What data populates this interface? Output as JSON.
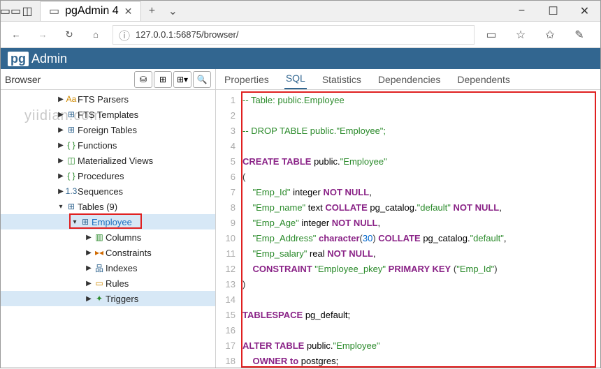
{
  "window": {
    "tab_title": "pgAdmin 4"
  },
  "addressbar": {
    "url": "127.0.0.1:56875/browser/"
  },
  "pgadmin": {
    "logo_prefix": "pg",
    "logo_text": "Admin"
  },
  "browser": {
    "title": "Browser",
    "watermark": "yiidian.com",
    "tree": [
      {
        "indent": 80,
        "exp": "▶",
        "icon": "Aa",
        "icon_color": "#d08a00",
        "label": "FTS Parsers"
      },
      {
        "indent": 80,
        "exp": "▶",
        "icon": "⊞",
        "icon_color": "#326690",
        "label": "FTS Templates"
      },
      {
        "indent": 80,
        "exp": "▶",
        "icon": "⊞",
        "icon_color": "#326690",
        "label": "Foreign Tables"
      },
      {
        "indent": 80,
        "exp": "▶",
        "icon": "{ }",
        "icon_color": "#2a8a2a",
        "label": "Functions"
      },
      {
        "indent": 80,
        "exp": "▶",
        "icon": "◫",
        "icon_color": "#2a8a2a",
        "label": "Materialized Views"
      },
      {
        "indent": 80,
        "exp": "▶",
        "icon": "{ }",
        "icon_color": "#2a8a2a",
        "label": "Procedures"
      },
      {
        "indent": 80,
        "exp": "▶",
        "icon": "1.3",
        "icon_color": "#326690",
        "label": "Sequences"
      },
      {
        "indent": 80,
        "exp": "▾",
        "icon": "⊞",
        "icon_color": "#326690",
        "label": "Tables (9)"
      },
      {
        "indent": 100,
        "exp": "▾",
        "icon": "⊞",
        "icon_color": "#326690",
        "label": "Employee",
        "selected": true,
        "blue": true,
        "boxed": true
      },
      {
        "indent": 120,
        "exp": "▶",
        "icon": "▥",
        "icon_color": "#2a8a2a",
        "label": "Columns"
      },
      {
        "indent": 120,
        "exp": "▶",
        "icon": "▸◂",
        "icon_color": "#d06a00",
        "label": "Constraints"
      },
      {
        "indent": 120,
        "exp": "▶",
        "icon": "品",
        "icon_color": "#326690",
        "label": "Indexes"
      },
      {
        "indent": 120,
        "exp": "▶",
        "icon": "▭",
        "icon_color": "#d08a00",
        "label": "Rules"
      },
      {
        "indent": 120,
        "exp": "▶",
        "icon": "✦",
        "icon_color": "#2a8a2a",
        "label": "Triggers",
        "selected_row": true
      }
    ]
  },
  "tabs": {
    "items": [
      "Properties",
      "SQL",
      "Statistics",
      "Dependencies",
      "Dependents"
    ],
    "active": 1
  },
  "code": {
    "lines": [
      [
        {
          "cls": "cmt",
          "t": "-- Table: public.Employee"
        }
      ],
      [],
      [
        {
          "cls": "cmt",
          "t": "-- DROP TABLE public.\"Employee\";"
        }
      ],
      [],
      [
        {
          "cls": "kw",
          "t": "CREATE TABLE"
        },
        {
          "t": " public."
        },
        {
          "cls": "str",
          "t": "\"Employee\""
        }
      ],
      [
        {
          "cls": "paren",
          "t": "("
        }
      ],
      [
        {
          "t": "    "
        },
        {
          "cls": "str",
          "t": "\"Emp_Id\""
        },
        {
          "t": " integer "
        },
        {
          "cls": "kw",
          "t": "NOT NULL"
        },
        {
          "t": ","
        }
      ],
      [
        {
          "t": "    "
        },
        {
          "cls": "str",
          "t": "\"Emp_name\""
        },
        {
          "t": " text "
        },
        {
          "cls": "kw",
          "t": "COLLATE"
        },
        {
          "t": " pg_catalog."
        },
        {
          "cls": "str",
          "t": "\"default\""
        },
        {
          "t": " "
        },
        {
          "cls": "kw",
          "t": "NOT NULL"
        },
        {
          "t": ","
        }
      ],
      [
        {
          "t": "    "
        },
        {
          "cls": "str",
          "t": "\"Emp_Age\""
        },
        {
          "t": " integer "
        },
        {
          "cls": "kw",
          "t": "NOT NULL"
        },
        {
          "t": ","
        }
      ],
      [
        {
          "t": "    "
        },
        {
          "cls": "str",
          "t": "\"Emp_Address\""
        },
        {
          "t": " "
        },
        {
          "cls": "typ",
          "t": "character"
        },
        {
          "cls": "paren",
          "t": "("
        },
        {
          "cls": "num",
          "t": "30"
        },
        {
          "cls": "paren",
          "t": ")"
        },
        {
          "t": " "
        },
        {
          "cls": "kw",
          "t": "COLLATE"
        },
        {
          "t": " pg_catalog."
        },
        {
          "cls": "str",
          "t": "\"default\""
        },
        {
          "t": ","
        }
      ],
      [
        {
          "t": "    "
        },
        {
          "cls": "str",
          "t": "\"Emp_salary\""
        },
        {
          "t": " real "
        },
        {
          "cls": "kw",
          "t": "NOT NULL"
        },
        {
          "t": ","
        }
      ],
      [
        {
          "t": "    "
        },
        {
          "cls": "kw",
          "t": "CONSTRAINT"
        },
        {
          "t": " "
        },
        {
          "cls": "str",
          "t": "\"Employee_pkey\""
        },
        {
          "t": " "
        },
        {
          "cls": "kw",
          "t": "PRIMARY KEY"
        },
        {
          "t": " "
        },
        {
          "cls": "paren",
          "t": "("
        },
        {
          "cls": "str",
          "t": "\"Emp_Id\""
        },
        {
          "cls": "paren",
          "t": ")"
        }
      ],
      [
        {
          "cls": "paren",
          "t": ")"
        }
      ],
      [],
      [
        {
          "cls": "kw",
          "t": "TABLESPACE"
        },
        {
          "t": " pg_default;"
        }
      ],
      [],
      [
        {
          "cls": "kw",
          "t": "ALTER TABLE"
        },
        {
          "t": " public."
        },
        {
          "cls": "str",
          "t": "\"Employee\""
        }
      ],
      [
        {
          "t": "    "
        },
        {
          "cls": "kw",
          "t": "OWNER to"
        },
        {
          "t": " postgres;"
        }
      ]
    ]
  }
}
